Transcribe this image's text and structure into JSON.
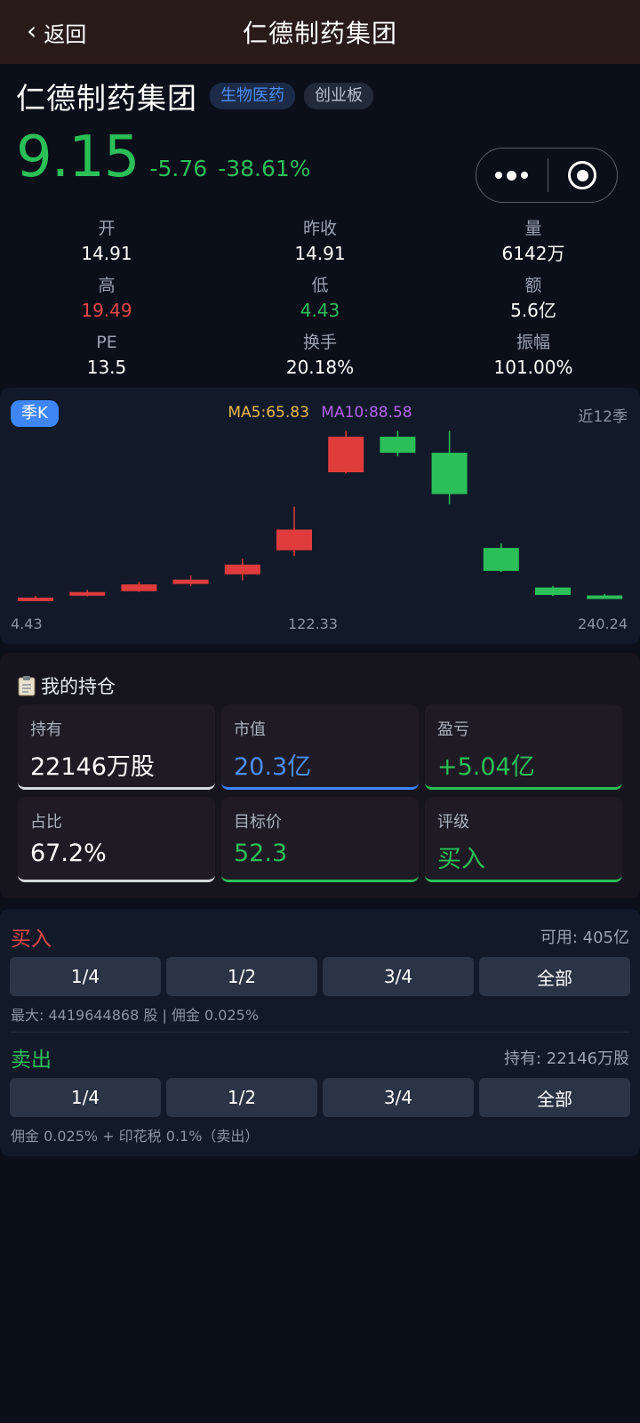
{
  "nav": {
    "back_label": "返回",
    "title": "仁德制药集团"
  },
  "stock": {
    "name": "仁德制药集团",
    "industry": "生物医药",
    "board": "创业板",
    "price": "9.15",
    "change": "-5.76",
    "change_pct": "-38.61%"
  },
  "stats": {
    "open": {
      "label": "开",
      "value": "14.91"
    },
    "prev_close": {
      "label": "昨收",
      "value": "14.91"
    },
    "volume": {
      "label": "量",
      "value": "6142万"
    },
    "high": {
      "label": "高",
      "value": "19.49"
    },
    "low": {
      "label": "低",
      "value": "4.43"
    },
    "amount": {
      "label": "额",
      "value": "5.6亿"
    },
    "pe": {
      "label": "PE",
      "value": "13.5"
    },
    "turnover": {
      "label": "换手",
      "value": "20.18%"
    },
    "amplitude": {
      "label": "振幅",
      "value": "101.00%"
    }
  },
  "chart": {
    "period": "季K",
    "ma5": "MA5:65.83",
    "ma10": "MA10:88.58",
    "range_label": "近12季",
    "axis_min": "4.43",
    "axis_mid": "122.33",
    "axis_max": "240.24"
  },
  "chart_data": {
    "type": "candlestick",
    "candles": [
      {
        "open": 4.7,
        "close": 4.6,
        "high": 6.1,
        "low": 4.43,
        "dir": "up"
      },
      {
        "open": 6.5,
        "close": 9.5,
        "high": 11.5,
        "low": 5.7,
        "dir": "up"
      },
      {
        "open": 10.3,
        "close": 16.2,
        "high": 18.3,
        "low": 9.7,
        "dir": "up"
      },
      {
        "open": 16.6,
        "close": 20.4,
        "high": 24.0,
        "low": 14.8,
        "dir": "up"
      },
      {
        "open": 25.0,
        "close": 33.5,
        "high": 38.5,
        "low": 19.8,
        "dir": "up"
      },
      {
        "open": 46.0,
        "close": 64.0,
        "high": 84.0,
        "low": 41.0,
        "dir": "up"
      },
      {
        "open": 114.0,
        "close": 145.0,
        "high": 150.0,
        "low": 113.0,
        "dir": "up"
      },
      {
        "open": 145.0,
        "close": 131.0,
        "high": 150.0,
        "low": 128.0,
        "dir": "down"
      },
      {
        "open": 131.0,
        "close": 95.0,
        "high": 150.0,
        "low": 86.0,
        "dir": "down"
      },
      {
        "open": 48.0,
        "close": 28.0,
        "high": 52.0,
        "low": 27.0,
        "dir": "down"
      },
      {
        "open": 13.5,
        "close": 7.0,
        "high": 15.0,
        "low": 6.0,
        "dir": "down"
      },
      {
        "open": 6.6,
        "close": 5.0,
        "high": 7.8,
        "low": 4.43,
        "dir": "down"
      }
    ],
    "colors": {
      "up": "#e03c3c",
      "down": "#2bbf58"
    }
  },
  "holdings": {
    "title": "我的持仓",
    "icon": "clipboard-icon",
    "cells": [
      {
        "label": "持有",
        "value": "22146万股"
      },
      {
        "label": "市值",
        "value": "20.3亿"
      },
      {
        "label": "盈亏",
        "value": "+5.04亿"
      },
      {
        "label": "占比",
        "value": "67.2%"
      },
      {
        "label": "目标价",
        "value": "52.3"
      },
      {
        "label": "评级",
        "value": "买入"
      }
    ]
  },
  "buy": {
    "title": "买入",
    "available": "可用: 405亿",
    "buttons": [
      "1/4",
      "1/2",
      "3/4",
      "全部"
    ],
    "note": "最大: 4419644868 股 | 佣金 0.025%"
  },
  "sell": {
    "title": "卖出",
    "holding": "持有: 22146万股",
    "buttons": [
      "1/4",
      "1/2",
      "3/4",
      "全部"
    ],
    "note": "佣金 0.025% + 印花税 0.1%（卖出）"
  },
  "colors": {
    "up": "#e14848",
    "down": "#2bbf58",
    "accent": "#3f86f5"
  }
}
